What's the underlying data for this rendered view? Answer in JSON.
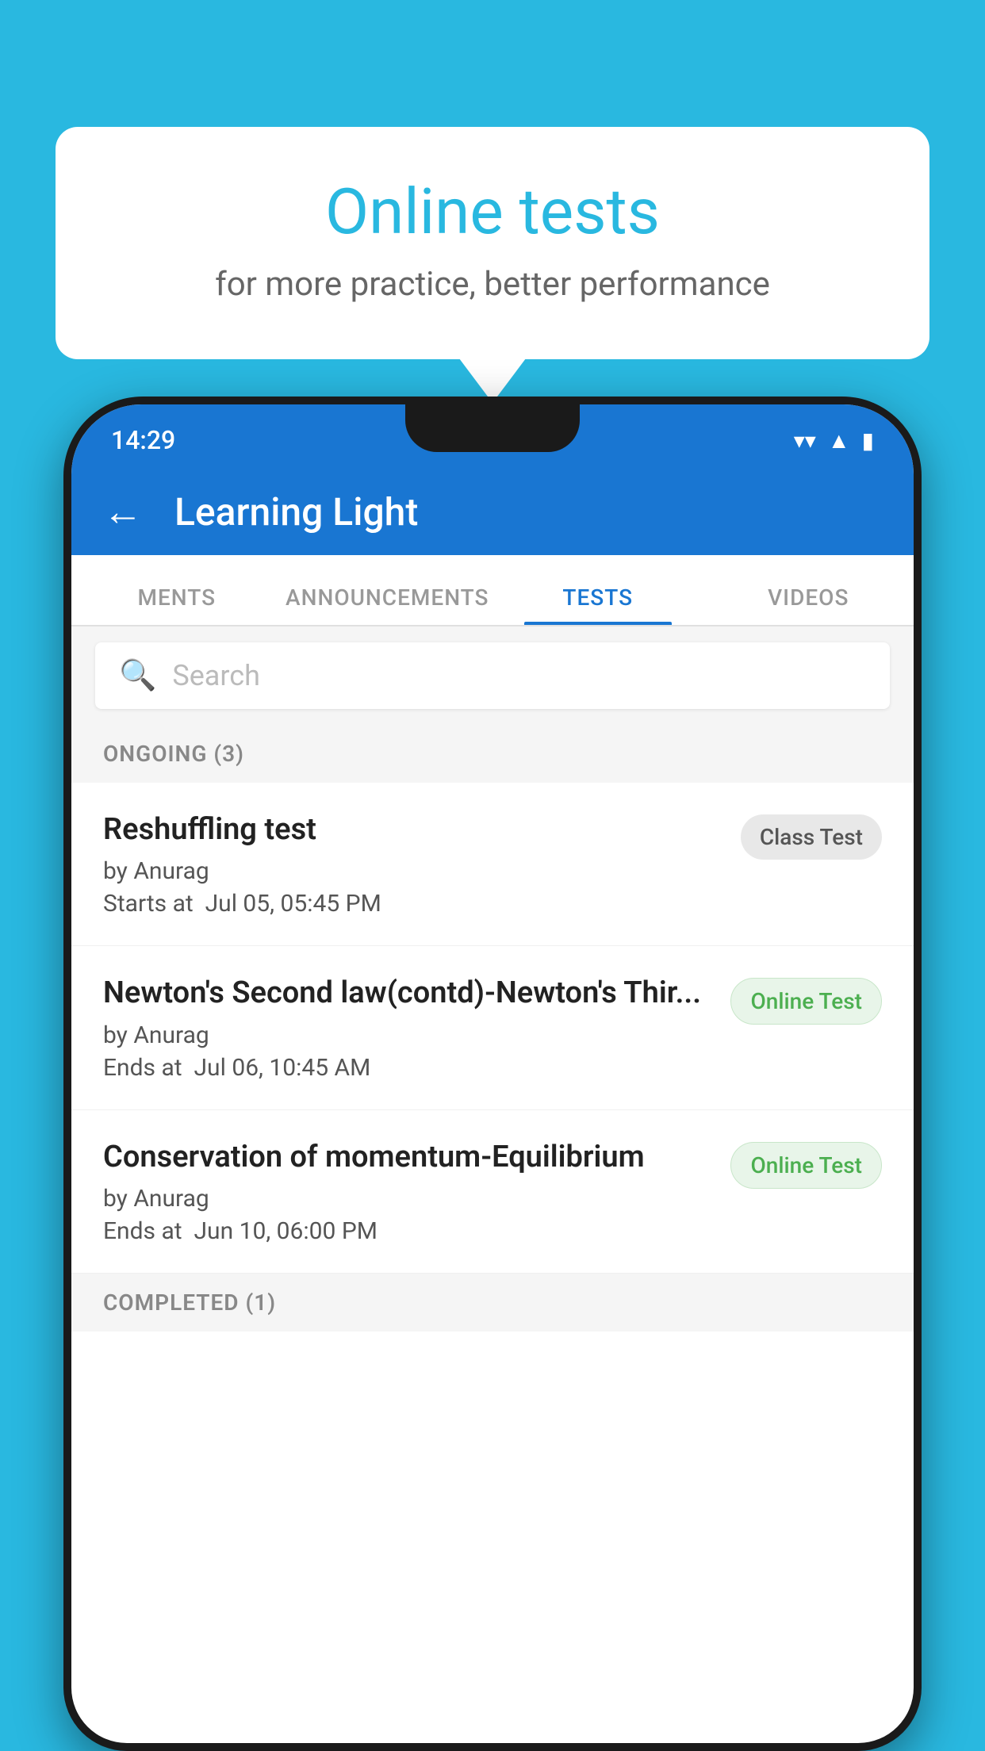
{
  "background": {
    "color": "#29b8e0"
  },
  "speechBubble": {
    "title": "Online tests",
    "subtitle": "for more practice, better performance"
  },
  "statusBar": {
    "time": "14:29",
    "wifiIcon": "▼",
    "signalIcon": "▲",
    "batteryIcon": "▮"
  },
  "appBar": {
    "title": "Learning Light",
    "backLabel": "←"
  },
  "tabs": [
    {
      "label": "MENTS",
      "active": false
    },
    {
      "label": "ANNOUNCEMENTS",
      "active": false
    },
    {
      "label": "TESTS",
      "active": true
    },
    {
      "label": "VIDEOS",
      "active": false
    }
  ],
  "search": {
    "placeholder": "Search"
  },
  "ongoing": {
    "sectionLabel": "ONGOING (3)",
    "items": [
      {
        "name": "Reshuffling test",
        "author": "by Anurag",
        "dateLabel": "Starts at",
        "date": "Jul 05, 05:45 PM",
        "badge": "Class Test",
        "badgeType": "class"
      },
      {
        "name": "Newton's Second law(contd)-Newton's Thir...",
        "author": "by Anurag",
        "dateLabel": "Ends at",
        "date": "Jul 06, 10:45 AM",
        "badge": "Online Test",
        "badgeType": "online"
      },
      {
        "name": "Conservation of momentum-Equilibrium",
        "author": "by Anurag",
        "dateLabel": "Ends at",
        "date": "Jun 10, 06:00 PM",
        "badge": "Online Test",
        "badgeType": "online"
      }
    ]
  },
  "completed": {
    "sectionLabel": "COMPLETED (1)"
  }
}
